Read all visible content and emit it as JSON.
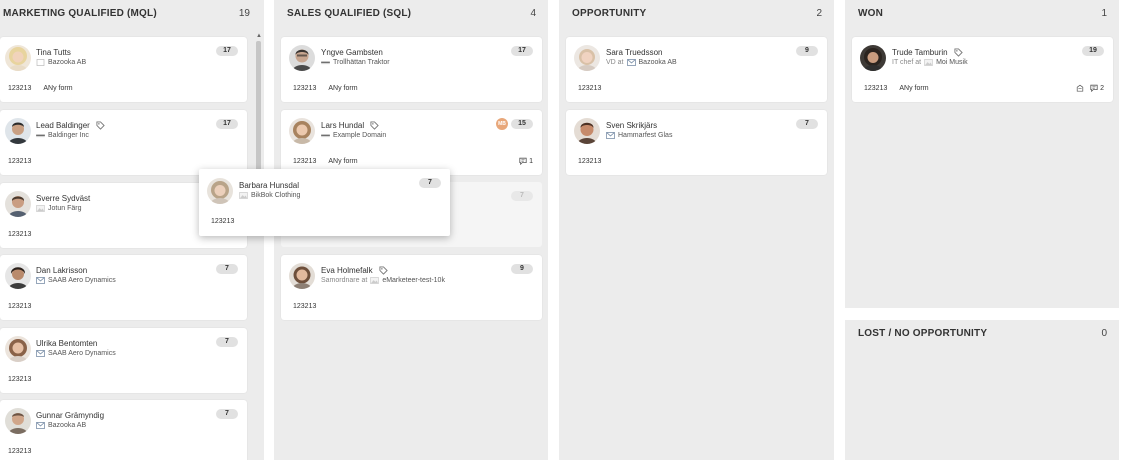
{
  "columns": [
    {
      "title": "MARKETING QUALIFIED (MQL)",
      "count": "19"
    },
    {
      "title": "SALES QUALIFIED (SQL)",
      "count": "4"
    },
    {
      "title": "OPPORTUNITY",
      "count": "2"
    },
    {
      "title": "WON",
      "count": "1"
    },
    {
      "title": "LOST / NO OPPORTUNITY",
      "count": "0"
    }
  ],
  "mql": [
    {
      "name": "Tina Tutts",
      "company": "Bazooka AB",
      "score": "17",
      "id": "123213",
      "form": "ANy form"
    },
    {
      "name": "Lead Baldinger",
      "company": "Baldinger Inc",
      "score": "17",
      "id": "123213"
    },
    {
      "name": "Sverre Sydväst",
      "company": "Jotun Färg",
      "id": "123213"
    },
    {
      "name": "Dan Lakrisson",
      "company": "SAAB Aero Dynamics",
      "score": "7",
      "id": "123213"
    },
    {
      "name": "Ulrika Bentomten",
      "company": "SAAB Aero Dynamics",
      "score": "7",
      "id": "123213"
    },
    {
      "name": "Gunnar Grämyndig",
      "company": "Bazooka AB",
      "score": "7",
      "id": "123213"
    }
  ],
  "sql": [
    {
      "name": "Yngve Gambsten",
      "company": "Trollhättan Traktor",
      "score": "17",
      "id": "123213",
      "form": "ANy form"
    },
    {
      "name": "Lars Hundal",
      "company": "Example Domain",
      "score": "15",
      "id": "123213",
      "form": "ANy form",
      "owner": "MB",
      "comments": "1"
    },
    {
      "score": "7"
    },
    {
      "name": "Eva Holmefalk",
      "title_prefix": "Samordnare at",
      "company": "eMarketeer-test-10k",
      "score": "9",
      "id": "123213"
    }
  ],
  "opportunity": [
    {
      "name": "Sara Truedsson",
      "title_prefix": "VD at",
      "company": "Bazooka AB",
      "score": "9",
      "id": "123213"
    },
    {
      "name": "Sven Skrikjärs",
      "company": "Hammarfest Glas",
      "score": "7",
      "id": "123213"
    }
  ],
  "won": [
    {
      "name": "Trude Tamburin",
      "title_prefix": "IT chef at",
      "company": "Moi Musik",
      "score": "19",
      "id": "123213",
      "form": "ANy form",
      "comments": "2"
    }
  ],
  "dragging": {
    "name": "Barbara Hunsdal",
    "company": "BikBok Clothing",
    "score": "7",
    "id": "123213"
  },
  "colors": {
    "column_bg": "#ececec",
    "card_bg": "#ffffff",
    "badge_bg": "#e1e1e1",
    "owner_badge": "#e8a77a"
  }
}
